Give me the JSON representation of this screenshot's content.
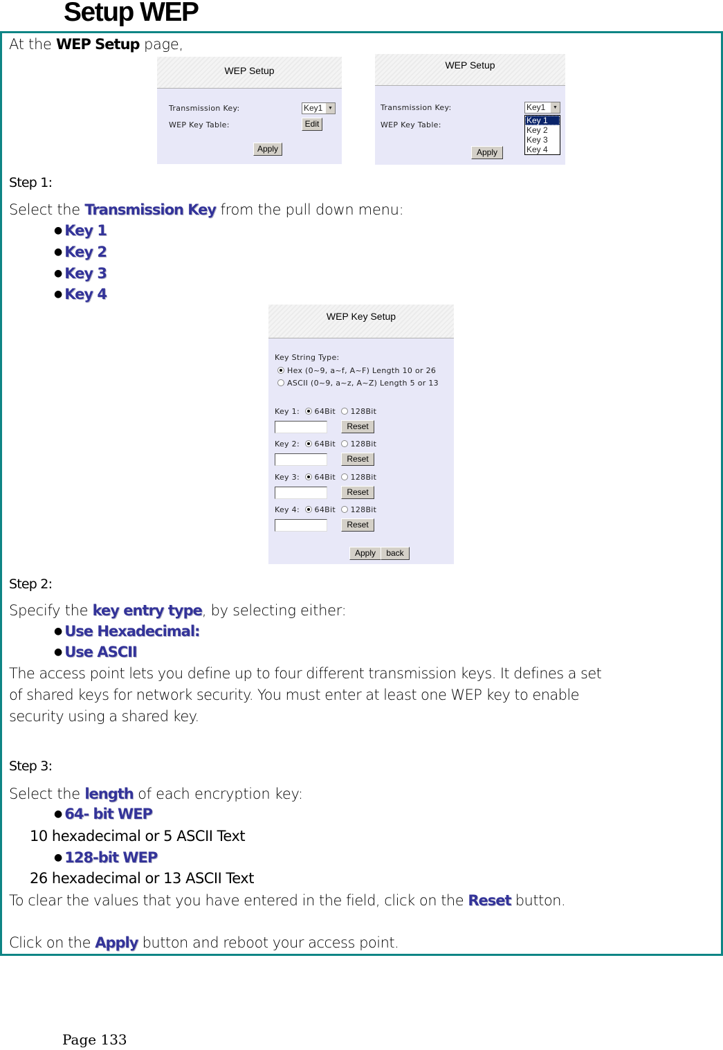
{
  "page": {
    "title": "Setup WEP",
    "footer": "Page 133"
  },
  "intro": {
    "prefix": "At the ",
    "highlight": "WEP Setup",
    "suffix": " page,"
  },
  "shot_wep_setup": {
    "header": "WEP Setup",
    "transmission_key_label": "Transmission Key:",
    "transmission_key_value": "Key1",
    "wep_key_table_label": "WEP Key Table:",
    "edit_label": "Edit",
    "apply_label": "Apply"
  },
  "shot_wep_setup_dropdown": {
    "header": "WEP Setup",
    "transmission_key_label": "Transmission Key:",
    "transmission_key_value": "Key1",
    "wep_key_table_label": "WEP Key Table:",
    "apply_label": "Apply",
    "options": [
      "Key 1",
      "Key 2",
      "Key 3",
      "Key 4"
    ],
    "selected": "Key 1"
  },
  "step1": {
    "label": "Step 1:",
    "prefix": "Select the ",
    "highlight": "Transmission Key",
    "suffix": " from the pull down menu:",
    "bullets": [
      "Key 1",
      "Key 2",
      "Key 3",
      "Key 4"
    ]
  },
  "shot_wep_key_setup": {
    "header": "WEP Key Setup",
    "key_string_type_label": "Key String Type:",
    "hex_option": "Hex (0~9, a~f, A~F) Length 10 or 26",
    "ascii_option": "ASCII (0~9, a~z, A~Z) Length 5 or 13",
    "bit64_label": "64Bit",
    "bit128_label": "128Bit",
    "reset_label": "Reset",
    "apply_label": "Apply",
    "back_label": "back",
    "keys": [
      {
        "label": "Key 1:",
        "value": ""
      },
      {
        "label": "Key 2:",
        "value": ""
      },
      {
        "label": "Key 3:",
        "value": ""
      },
      {
        "label": "Key 4:",
        "value": ""
      }
    ]
  },
  "step2": {
    "label": "Step 2:",
    "prefix": "Specify the ",
    "highlight": "key entry type",
    "suffix": ", by selecting either:",
    "bullets": [
      "Use Hexadecimal:",
      "Use ASCII"
    ],
    "paragraph": [
      "The access point lets you define up to four different transmission keys. It defines a set",
      "of shared keys for network security. You must enter at least one WEP key to enable",
      "security using a shared key."
    ]
  },
  "step3": {
    "label": "Step 3:",
    "prefix": "Select the ",
    "highlight": "length",
    "suffix": " of each encryption key:",
    "bullets": [
      {
        "label": "64- bit WEP",
        "desc": "10 hexadecimal or 5 ASCII Text"
      },
      {
        "label": "128-bit WEP",
        "desc": "26 hexadecimal or 13 ASCII Text"
      }
    ]
  },
  "reset_note": {
    "prefix": "To clear the values that you have entered in the field, click on the ",
    "highlight": "Reset",
    "suffix": " button."
  },
  "apply_note": {
    "prefix": "Click on the ",
    "highlight": "Apply",
    "suffix": " button and reboot your access point."
  },
  "colors": {
    "border": "#0e8585",
    "highlight": "#333399",
    "ui_background": "#e8e8f8",
    "selected_option": "#0a246a"
  }
}
